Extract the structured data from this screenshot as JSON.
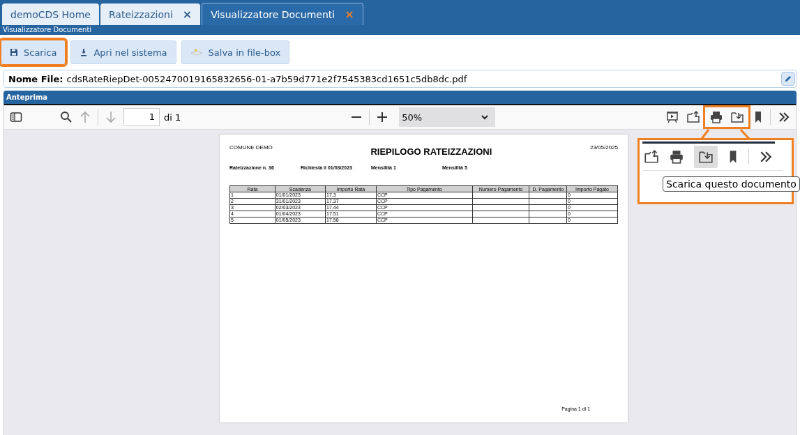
{
  "tabs": [
    {
      "label": "demoCDS Home",
      "selected": false
    },
    {
      "label": "Rateizzazioni",
      "selected": false,
      "close": "×"
    },
    {
      "label": "Visualizzatore Documenti",
      "selected": true,
      "close": "×"
    }
  ],
  "subtitle": "Visualizzatore Documenti",
  "buttons": [
    {
      "label": "Scarica",
      "kind": "save",
      "highlighted": true
    },
    {
      "label": "Apri nel sistema",
      "kind": "download",
      "highlighted": false
    },
    {
      "label": "Salva in file-box",
      "kind": "filebox",
      "highlighted": false
    }
  ],
  "file": {
    "label": "Nome File:",
    "value": "cdsRateRiepDet-0052470019165832656-01-a7b59d771e2f7545383cd1651c5db8dc.pdf"
  },
  "preview": {
    "title": "Anteprima",
    "page": "1",
    "page_count": "di 1",
    "zoom": "50%",
    "highlighted": true
  },
  "document": {
    "org": "COMUNE DEMO",
    "title": "RIEPILOGO RATEIZZAZIONI",
    "date": "23/05/2025",
    "info": [
      "Rateizzazione n. 36",
      "Richiesta il 01/03/2023",
      "Mensilità 1",
      "Mensilità 5"
    ],
    "columns": [
      "Rata",
      "Scadenza",
      "Importo Rata",
      "Tipo Pagamento",
      "Numero Pagamento",
      "D. Pagamento",
      "Importo Pagato"
    ],
    "rows": [
      [
        "1",
        "01/01/2023",
        "17.3",
        "CCP",
        "",
        "",
        "0"
      ],
      [
        "2",
        "31/01/2023",
        "17.37",
        "CCP",
        "",
        "",
        "0"
      ],
      [
        "3",
        "02/03/2023",
        "17.44",
        "CCP",
        "",
        "",
        "0"
      ],
      [
        "4",
        "01/04/2023",
        "17.51",
        "CCP",
        "",
        "",
        "0"
      ],
      [
        "5",
        "01/05/2023",
        "17.58",
        "CCP",
        "",
        "",
        "0"
      ]
    ],
    "footer": "Pagina 1 di 1"
  },
  "callout": {
    "tooltip": "Scarica questo documento"
  }
}
